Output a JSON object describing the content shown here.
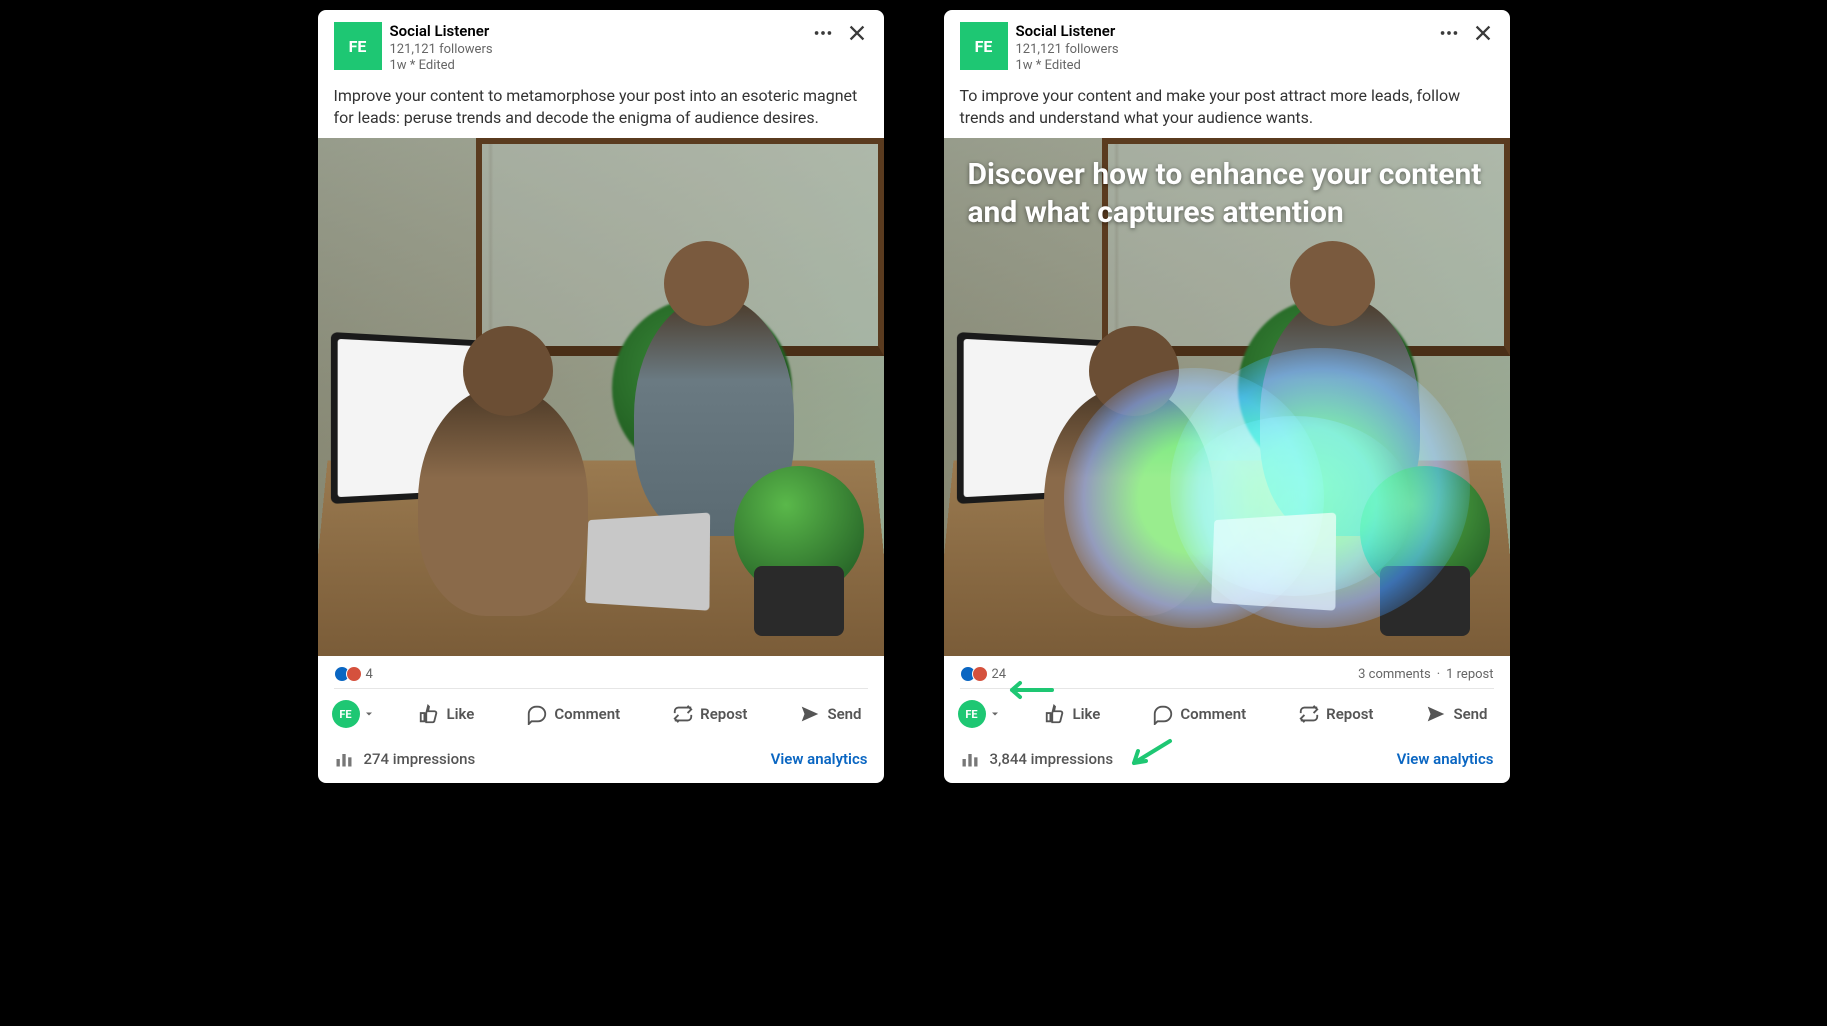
{
  "posts": [
    {
      "avatar_initials": "FE",
      "author": "Social Listener",
      "followers": "121,121 followers",
      "timestamp": "1w * Edited",
      "body": "Improve your content to metamorphose your post into an esoteric magnet for leads: peruse trends and decode the enigma of audience desires.",
      "image_overlay": "",
      "has_heatmap": false,
      "reactions_count": "4",
      "comments_text": "",
      "reposts_text": "",
      "impressions": "274 impressions",
      "view_analytics": "View analytics",
      "annot_reactions": false,
      "annot_impressions": false
    },
    {
      "avatar_initials": "FE",
      "author": "Social Listener",
      "followers": "121,121 followers",
      "timestamp": "1w * Edited",
      "body": "To improve your content and make your post attract more leads, follow trends and understand what your audience wants.",
      "image_overlay": "Discover how to enhance your content and what captures attention",
      "has_heatmap": true,
      "reactions_count": "24",
      "comments_text": "3 comments",
      "reposts_text": "1 repost",
      "impressions": "3,844 impressions",
      "view_analytics": "View analytics",
      "annot_reactions": true,
      "annot_impressions": true
    }
  ],
  "actions": {
    "like": "Like",
    "comment": "Comment",
    "repost": "Repost",
    "send": "Send"
  },
  "commenter_initials": "FE"
}
